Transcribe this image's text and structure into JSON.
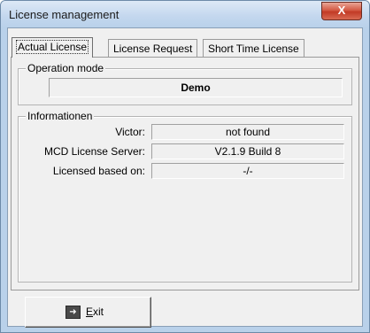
{
  "window": {
    "title": "License management",
    "close_glyph": "X"
  },
  "tabs": [
    {
      "label": "Actual License",
      "active": true
    },
    {
      "label": "License Request",
      "active": false
    },
    {
      "label": "Short Time License",
      "active": false
    }
  ],
  "operation_mode": {
    "label": "Operation mode",
    "value": "Demo"
  },
  "info": {
    "label": "Informationen",
    "rows": [
      {
        "label": "Victor:",
        "value": "not found"
      },
      {
        "label": "MCD License Server:",
        "value": "V2.1.9 Build 8"
      },
      {
        "label": "Licensed based on:",
        "value": "-/-"
      }
    ]
  },
  "exit_button": {
    "mnemonic": "E",
    "rest": "xit",
    "icon": "exit-door-icon"
  }
}
